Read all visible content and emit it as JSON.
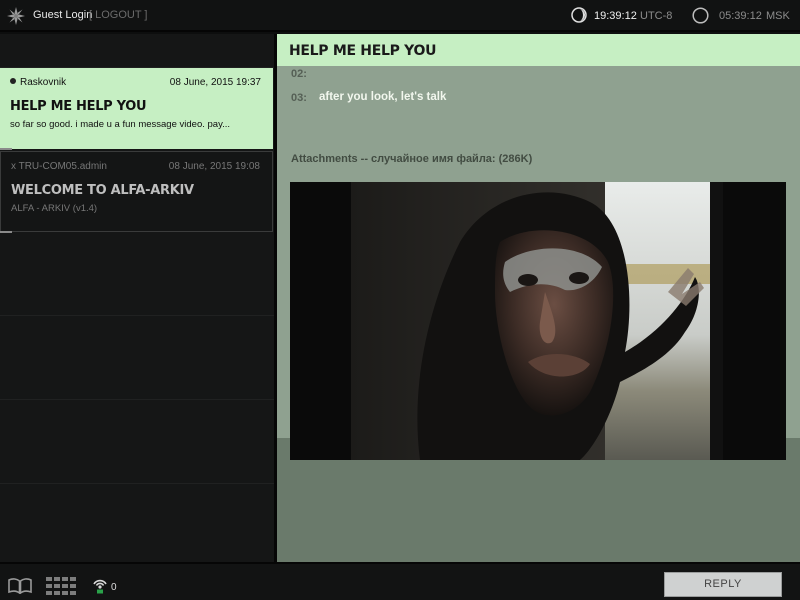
{
  "topbar": {
    "user_label": "Guest Login",
    "logout_label": "[ LOGOUT ]",
    "clock_local_time": "19:39:12",
    "clock_local_tz": "UTC-8",
    "clock_remote_time": "05:39:12",
    "clock_remote_tz": "MSK"
  },
  "sidebar": {
    "messages": [
      {
        "sender": "Raskovnik",
        "date": "08 June, 2015 19:37",
        "title": "HELP ME HELP YOU",
        "preview": "so far so good. i made u a fun message video. pay...",
        "read": false,
        "active": true
      },
      {
        "sender": "x TRU-COM05.admin",
        "date": "08 June, 2015 19:08",
        "title": "WELCOME TO ALFA-ARKIV",
        "preview": "ALFA - ARKIV  (v1.4)",
        "read": true,
        "active": false
      }
    ]
  },
  "main": {
    "title": "HELP ME HELP YOU",
    "lines": [
      {
        "num": "02:",
        "text": ""
      },
      {
        "num": "03:",
        "text": "after you look, let's talk"
      }
    ],
    "attachment_label": "Attachments -- случайное имя файла: (286K)"
  },
  "bottombar": {
    "signal_count": "0",
    "reply_label": "REPLY"
  },
  "colors": {
    "accent": "#c6efc3",
    "main_bg": "#8fa190",
    "dark_bg": "#111212"
  },
  "icons": [
    "logo-icon",
    "moon-clock-icon",
    "circle-clock-icon",
    "book-icon",
    "grid-icon",
    "signal-icon"
  ]
}
